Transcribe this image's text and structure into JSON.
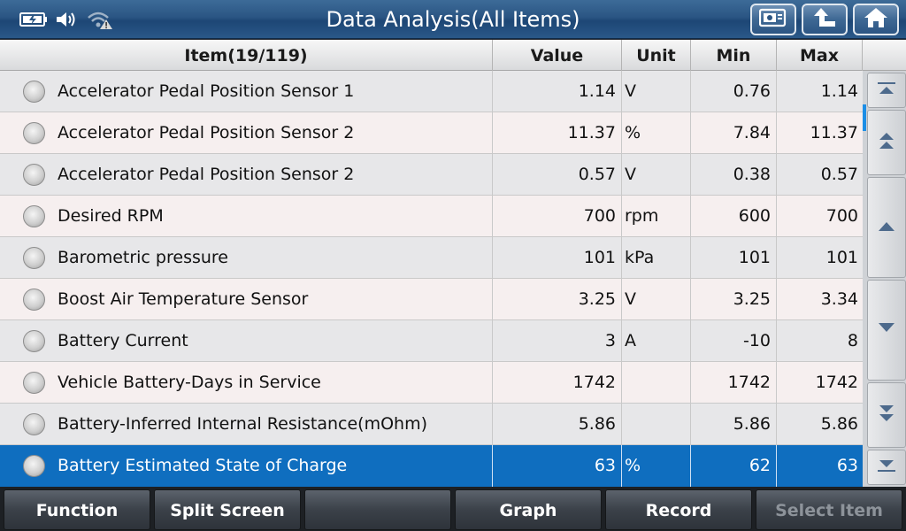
{
  "header": {
    "title": "Data Analysis(All Items)",
    "icons": [
      "battery-icon",
      "speaker-icon",
      "wifi-warning-icon"
    ],
    "buttons": [
      "screenshot-icon",
      "back-icon",
      "home-icon"
    ]
  },
  "table": {
    "columns": {
      "item": "Item(19/119)",
      "value": "Value",
      "unit": "Unit",
      "min": "Min",
      "max": "Max"
    },
    "rows": [
      {
        "item": "Accelerator Pedal Position Sensor 1",
        "value": "1.14",
        "unit": "V",
        "min": "0.76",
        "max": "1.14"
      },
      {
        "item": "Accelerator Pedal Position Sensor 2",
        "value": "11.37",
        "unit": "%",
        "min": "7.84",
        "max": "11.37"
      },
      {
        "item": "Accelerator Pedal Position Sensor 2",
        "value": "0.57",
        "unit": "V",
        "min": "0.38",
        "max": "0.57"
      },
      {
        "item": "Desired RPM",
        "value": "700",
        "unit": "rpm",
        "min": "600",
        "max": "700"
      },
      {
        "item": "Barometric pressure",
        "value": "101",
        "unit": "kPa",
        "min": "101",
        "max": "101"
      },
      {
        "item": "Boost Air Temperature Sensor",
        "value": "3.25",
        "unit": "V",
        "min": "3.25",
        "max": "3.34"
      },
      {
        "item": "Battery Current",
        "value": "3",
        "unit": "A",
        "min": "-10",
        "max": "8"
      },
      {
        "item": "Vehicle Battery-Days in Service",
        "value": "1742",
        "unit": "",
        "min": "1742",
        "max": "1742"
      },
      {
        "item": "Battery-Inferred Internal Resistance(mOhm)",
        "value": "5.86",
        "unit": "",
        "min": "5.86",
        "max": "5.86"
      },
      {
        "item": "Battery Estimated State of Charge",
        "value": "63",
        "unit": "%",
        "min": "62",
        "max": "63"
      }
    ],
    "selected_row": 9
  },
  "scroll": [
    "scroll-top-icon",
    "page-up-icon",
    "scroll-up-icon",
    "scroll-down-icon",
    "page-down-icon",
    "scroll-bottom-icon"
  ],
  "footer": {
    "function": "Function",
    "split_screen": "Split Screen",
    "empty": "",
    "graph": "Graph",
    "record": "Record",
    "select_item": "Select Item"
  },
  "colors": {
    "title_bar": "#2a5583",
    "selected_row": "#0f6ebf",
    "scroll_thumb": "#1c8ee6"
  }
}
